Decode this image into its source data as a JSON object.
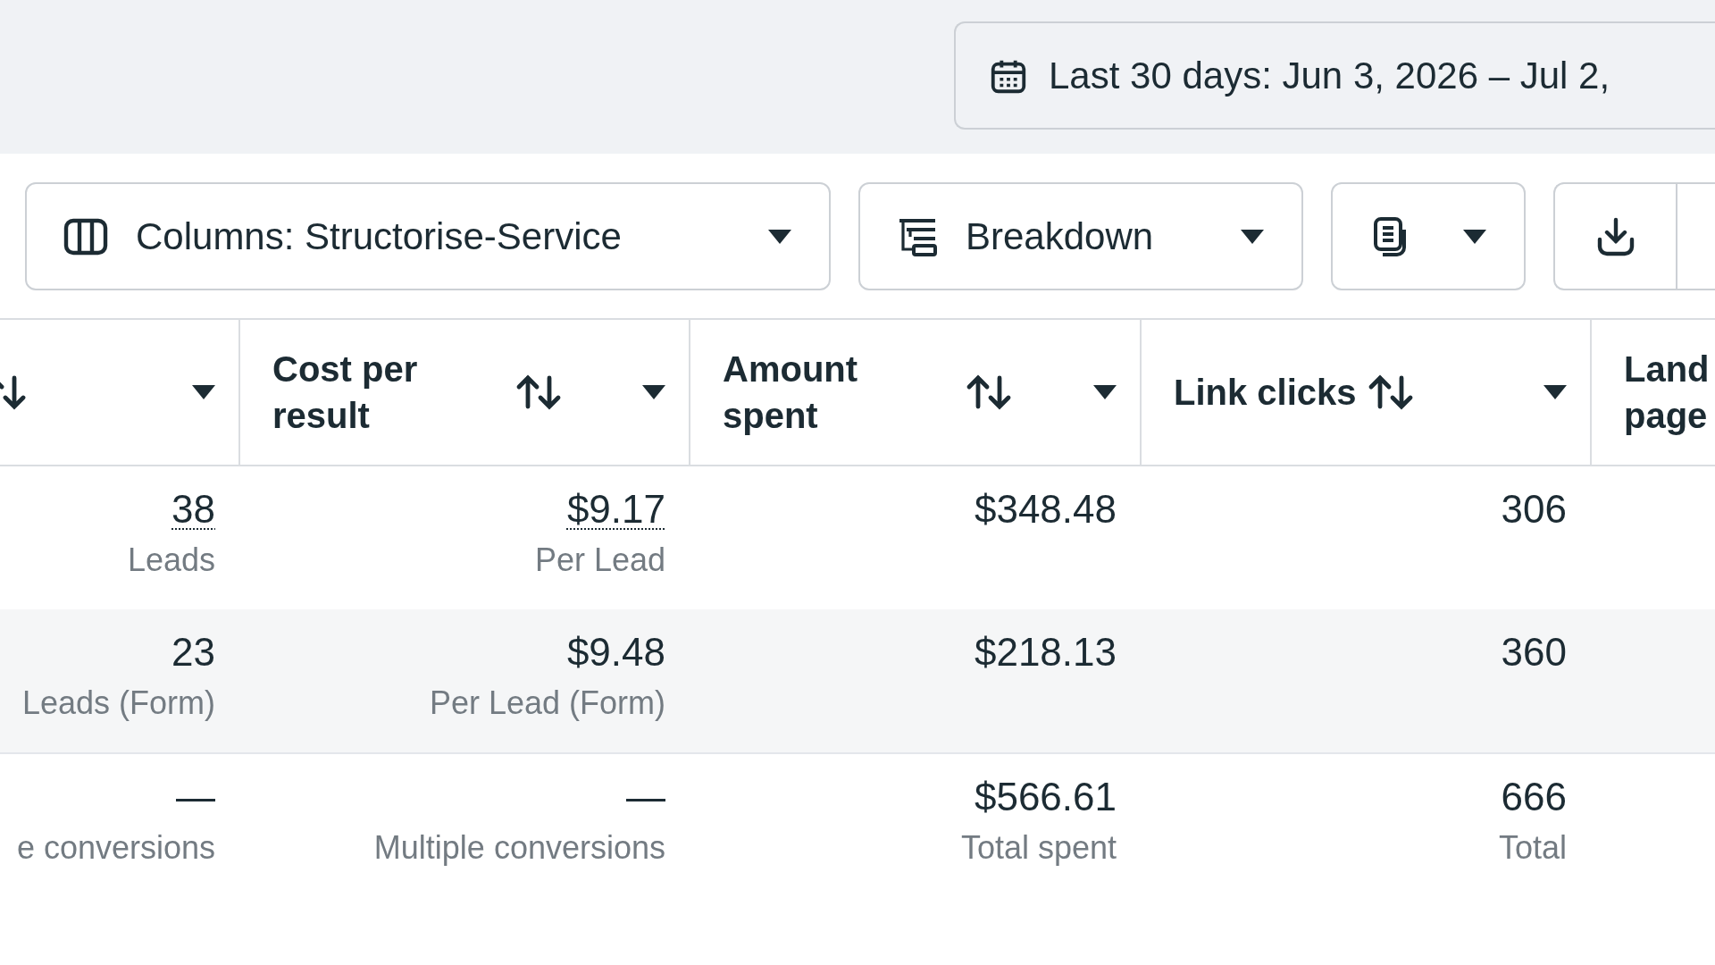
{
  "date_range": {
    "label": "Last 30 days: Jun 3, 2026 – Jul 2,"
  },
  "toolbar": {
    "buttons": [
      {
        "kind": "columns",
        "label": "Columns: Structorise-Service",
        "dropdown": true
      },
      {
        "kind": "breakdown",
        "label": "Breakdown",
        "dropdown": true
      },
      {
        "kind": "reports",
        "dropdown": true
      },
      {
        "kind": "export",
        "dropdown": false
      },
      {
        "kind": "more",
        "dropdown": false
      }
    ]
  },
  "table": {
    "columns": [
      {
        "kind": "sortable"
      },
      {
        "label": "Cost per result",
        "kind": "sortable"
      },
      {
        "label": "Amount spent",
        "kind": "sortable"
      },
      {
        "label": "Link clicks",
        "kind": "sortable"
      },
      {
        "label": "Land page",
        "kind": "plain"
      }
    ],
    "rows": [
      {
        "highlighted": false,
        "cells": [
          {
            "value": "38",
            "sub": "Leads",
            "dotted_underline": true
          },
          {
            "value": "$9.17",
            "sub": "Per Lead",
            "dotted_underline": true
          },
          {
            "value": "$348.48",
            "dotted_underline": false
          },
          {
            "value": "306",
            "dotted_underline": false
          }
        ]
      },
      {
        "highlighted": true,
        "cells": [
          {
            "value": "23",
            "sub": "Leads (Form)",
            "dotted_underline": false
          },
          {
            "value": "$9.48",
            "sub": "Per Lead (Form)",
            "dotted_underline": false
          },
          {
            "value": "$218.13",
            "dotted_underline": false
          },
          {
            "value": "360",
            "dotted_underline": false
          }
        ]
      }
    ],
    "totals": {
      "cells": [
        {
          "value": "—",
          "sub": "e conversions",
          "dotted_underline": false
        },
        {
          "value": "—",
          "sub": "Multiple conversions",
          "dotted_underline": false
        },
        {
          "value": "$566.61",
          "sub": "Total spent",
          "dotted_underline": false
        },
        {
          "value": "666",
          "sub": "Total",
          "dotted_underline": false
        }
      ]
    }
  }
}
